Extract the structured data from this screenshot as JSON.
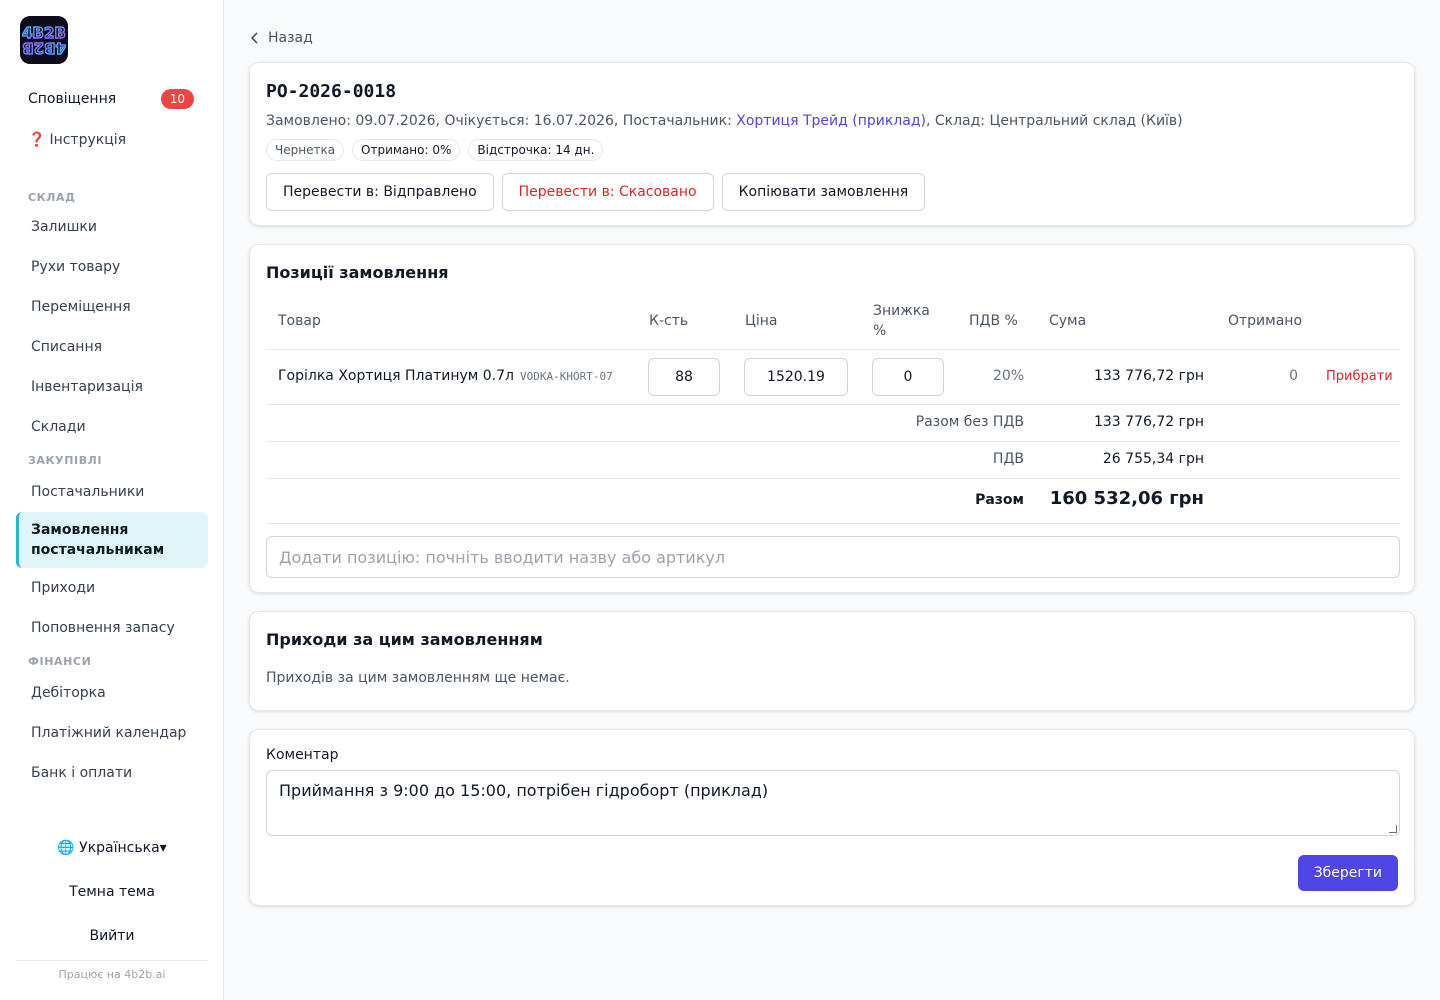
{
  "sidebar": {
    "notifications": {
      "label": "Сповіщення",
      "count": "10"
    },
    "instructions": {
      "icon": "❓",
      "label": "Інструкція"
    },
    "sections": [
      {
        "title": "СКЛАД",
        "items": [
          "Залишки",
          "Рухи товару",
          "Переміщення",
          "Списання",
          "Інвентаризація",
          "Склади"
        ]
      },
      {
        "title": "ЗАКУПІВЛІ",
        "items": [
          "Постачальники",
          "Замовлення постачальникам",
          "Приходи",
          "Поповнення запасу"
        ]
      },
      {
        "title": "ФІНАНСИ",
        "items": [
          "Дебіторка",
          "Платіжний календар",
          "Банк і оплати"
        ]
      }
    ],
    "active_item": "Замовлення постачальникам",
    "language": "🌐 Українська▾",
    "theme_toggle": "Темна тема",
    "logout": "Вийти",
    "powered_by": "Працює на 4b2b.ai",
    "logo_text": "4B2B"
  },
  "back": {
    "label": "Назад"
  },
  "order": {
    "number": "PO-2026-0018",
    "meta_prefix": "Замовлено: 09.07.2026, Очікується: 16.07.2026, Постачальник: ",
    "supplier": "Хортиця Трейд (приклад)",
    "meta_suffix": ", Склад: Центральний склад (Київ)",
    "chips": [
      "Чернетка",
      "Отримано: 0%",
      "Відстрочка: 14 дн."
    ],
    "actions": [
      "Перевести в: Відправлено",
      "Перевести в: Скасовано",
      "Копіювати замовлення"
    ]
  },
  "positions": {
    "title": "Позиції замовлення",
    "headers": {
      "product": "Товар",
      "qty": "К-сть",
      "price": "Ціна",
      "discount": "Знижка %",
      "vat": "ПДВ %",
      "sum": "Сума",
      "received": "Отримано"
    },
    "rows": [
      {
        "product": "Горілка Хортиця Платинум 0.7л",
        "sku": "VODKA-KHORT-07",
        "qty": "88",
        "price": "1520.19",
        "discount": "0",
        "vat": "20%",
        "sum": "133 776,72 грн",
        "received": "0",
        "remove": "Прибрати"
      }
    ],
    "totals": {
      "net_label": "Разом без ПДВ",
      "net_value": "133 776,72 грн",
      "vat_label": "ПДВ",
      "vat_value": "26 755,34 грн",
      "total_label": "Разом",
      "total_value": "160 532,06 грн"
    },
    "add_placeholder": "Додати позицію: почніть вводити назву або артикул"
  },
  "receipts": {
    "title": "Приходи за цим замовленням",
    "empty": "Приходів за цим замовленням ще немає."
  },
  "comment": {
    "label": "Коментар",
    "value": "Приймання з 9:00 до 15:00, потрібен гідроборт (приклад)",
    "save": "Зберегти"
  },
  "colors": {
    "accent": "#4f46e5",
    "danger": "#dc2626",
    "active_nav_bg": "#dff5fa",
    "active_nav_border": "#22b8cf",
    "badge": "#ef4444"
  }
}
